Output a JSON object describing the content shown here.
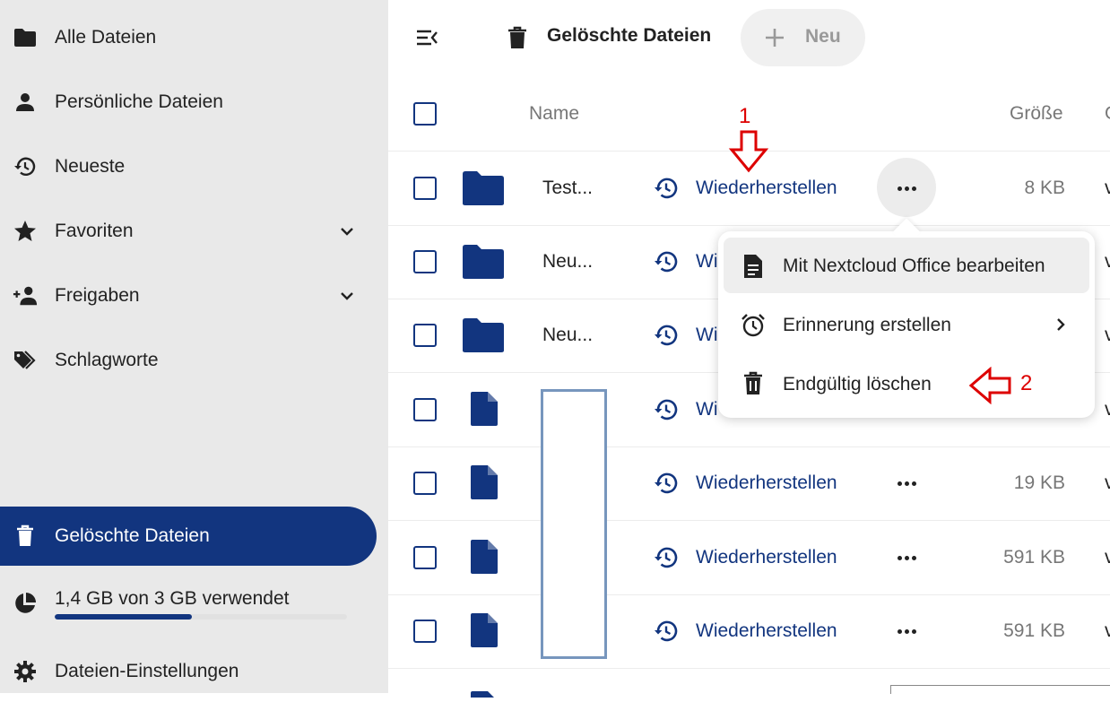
{
  "sidebar": {
    "items": [
      {
        "label": "Alle Dateien",
        "icon": "folder-icon"
      },
      {
        "label": "Persönliche Dateien",
        "icon": "person-icon"
      },
      {
        "label": "Neueste",
        "icon": "history-icon"
      },
      {
        "label": "Favoriten",
        "icon": "star-icon",
        "expandable": true
      },
      {
        "label": "Freigaben",
        "icon": "share-person-icon",
        "expandable": true
      },
      {
        "label": "Schlagworte",
        "icon": "tags-icon"
      },
      {
        "label": "Gelöschte Dateien",
        "icon": "trash-icon",
        "active": true
      }
    ],
    "quota": {
      "label": "1,4 GB von 3 GB verwendet",
      "used_fraction": 0.47
    },
    "settings_label": "Dateien-Einstellungen"
  },
  "header": {
    "title": "Gelöschte Dateien",
    "new_button_label": "Neu"
  },
  "table": {
    "columns": {
      "name": "Name",
      "size": "Größe",
      "more": "G"
    },
    "rows": [
      {
        "name": "Test...",
        "type": "folder",
        "restore": "Wiederherstellen",
        "size": "8 KB",
        "trailing": "v"
      },
      {
        "name": "Neu...",
        "type": "folder",
        "restore": "Wi",
        "size": "",
        "trailing": "v"
      },
      {
        "name": "Neu...",
        "type": "folder",
        "restore": "Wi",
        "size": "",
        "trailing": "v"
      },
      {
        "name": "",
        "type": "file",
        "restore": "Wi",
        "size": "",
        "trailing": "v"
      },
      {
        "name": "",
        "type": "file",
        "restore": "Wiederherstellen",
        "size": "19 KB",
        "trailing": "v"
      },
      {
        "name": "",
        "type": "file",
        "restore": "Wiederherstellen",
        "size": "591 KB",
        "trailing": "v"
      },
      {
        "name": "",
        "type": "file",
        "restore": "Wiederherstellen",
        "size": "591 KB",
        "trailing": "v"
      }
    ]
  },
  "context_menu": {
    "items": [
      {
        "label": "Mit Nextcloud Office bearbeiten",
        "icon": "document-icon"
      },
      {
        "label": "Erinnerung erstellen",
        "icon": "alarm-icon",
        "submenu": true
      },
      {
        "label": "Endgültig löschen",
        "icon": "trash-icon"
      }
    ]
  },
  "annotations": {
    "arrow1_label": "1",
    "arrow2_label": "2"
  },
  "colors": {
    "accent": "#12357f",
    "annotation": "#d00000",
    "sidebar_bg": "#e9e9e9"
  }
}
